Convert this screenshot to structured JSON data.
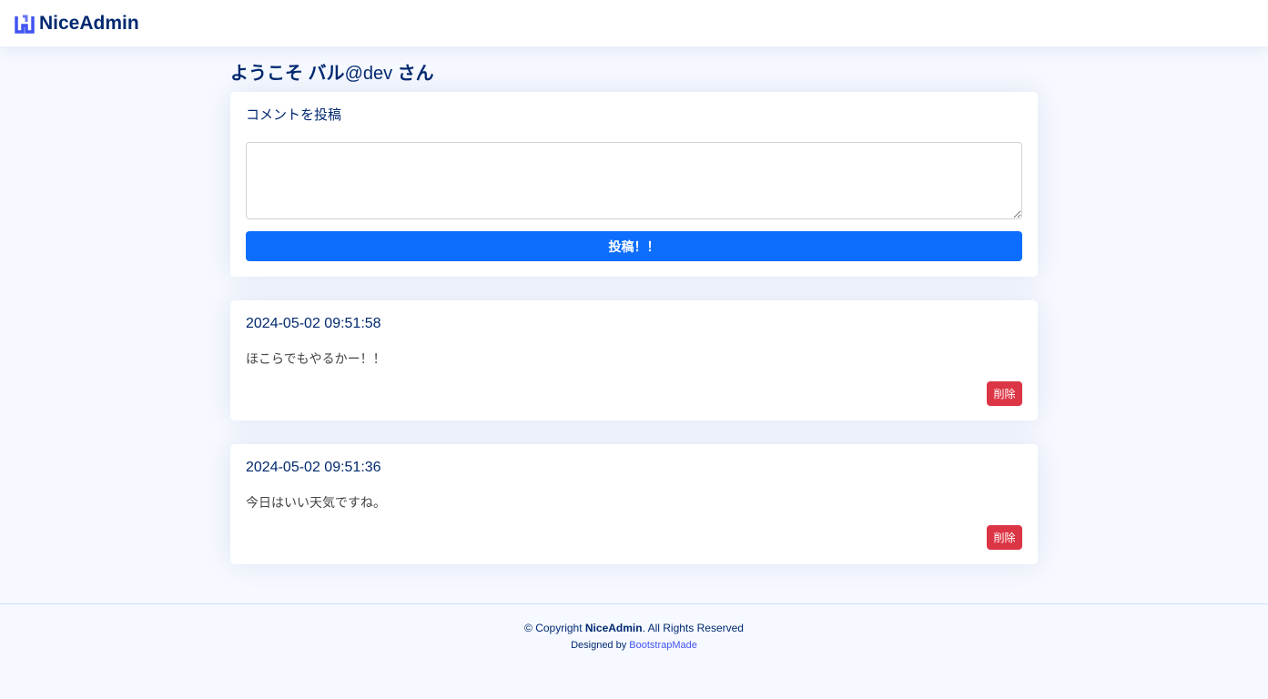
{
  "header": {
    "logo_text": "NiceAdmin",
    "logo_icon": "niceadmin-logo-icon"
  },
  "main": {
    "welcome": {
      "prefix": "ようこそ バル",
      "handle": "@dev",
      "suffix": " さん"
    },
    "post_form": {
      "title": "コメントを投稿",
      "input_value": "",
      "submit_label": "投稿！！"
    },
    "comments": [
      {
        "timestamp": "2024-05-02 09:51:58",
        "text": "ほこらでもやるかー！！",
        "delete_label": "削除"
      },
      {
        "timestamp": "2024-05-02 09:51:36",
        "text": "今日はいい天気ですね。",
        "delete_label": "削除"
      }
    ]
  },
  "footer": {
    "copyright_prefix": "© Copyright ",
    "copyright_brand": "NiceAdmin",
    "copyright_suffix": ". All Rights Reserved",
    "designed_by": "Designed by ",
    "designer_link": "BootstrapMade"
  },
  "colors": {
    "primary": "#0d6efd",
    "danger": "#dc3545",
    "brand": "#012970",
    "link": "#4154f1",
    "background": "#f6f9ff"
  }
}
